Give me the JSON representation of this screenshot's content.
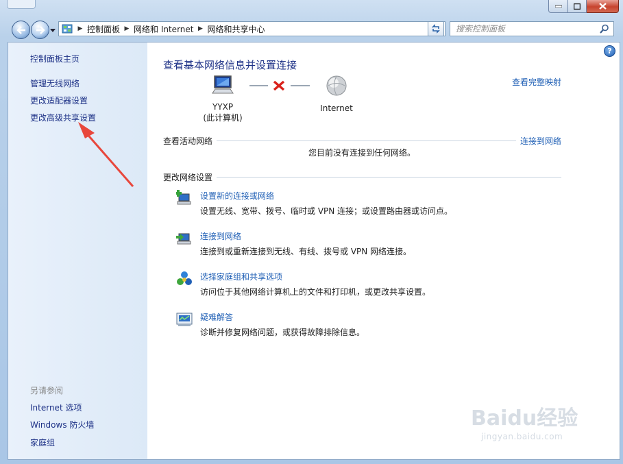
{
  "window": {
    "buttons": {
      "minimize": "minimize-icon",
      "maximize": "maximize-icon",
      "close": "close-icon"
    }
  },
  "nav": {
    "breadcrumbs": [
      "控制面板",
      "网络和 Internet",
      "网络和共享中心"
    ],
    "search_placeholder": "搜索控制面板"
  },
  "sidebar": {
    "home": "控制面板主页",
    "items": [
      "管理无线网络",
      "更改适配器设置",
      "更改高级共享设置"
    ],
    "see_also_heading": "另请参阅",
    "see_also": [
      "Internet 选项",
      "Windows 防火墙",
      "家庭组"
    ]
  },
  "main": {
    "title": "查看基本网络信息并设置连接",
    "full_map_link": "查看完整映射",
    "computer_name": "YYXP",
    "computer_sub": "(此计算机)",
    "internet_label": "Internet",
    "active_section": "查看活动网络",
    "connect_link": "连接到网络",
    "no_network": "您目前没有连接到任何网络。",
    "change_section": "更改网络设置",
    "tasks": [
      {
        "title": "设置新的连接或网络",
        "desc": "设置无线、宽带、拨号、临时或 VPN 连接；或设置路由器或访问点。"
      },
      {
        "title": "连接到网络",
        "desc": "连接到或重新连接到无线、有线、拨号或 VPN 网络连接。"
      },
      {
        "title": "选择家庭组和共享选项",
        "desc": "访问位于其他网络计算机上的文件和打印机，或更改共享设置。"
      },
      {
        "title": "疑难解答",
        "desc": "诊断并修复网络问题，或获得故障排除信息。"
      }
    ]
  },
  "watermark": {
    "brand": "Baidu经验",
    "url": "jingyan.baidu.com"
  },
  "colors": {
    "link": "#1f5fb5",
    "title": "#1e3287",
    "sidebar": "#e4eef9",
    "arrow": "#e8473c"
  }
}
